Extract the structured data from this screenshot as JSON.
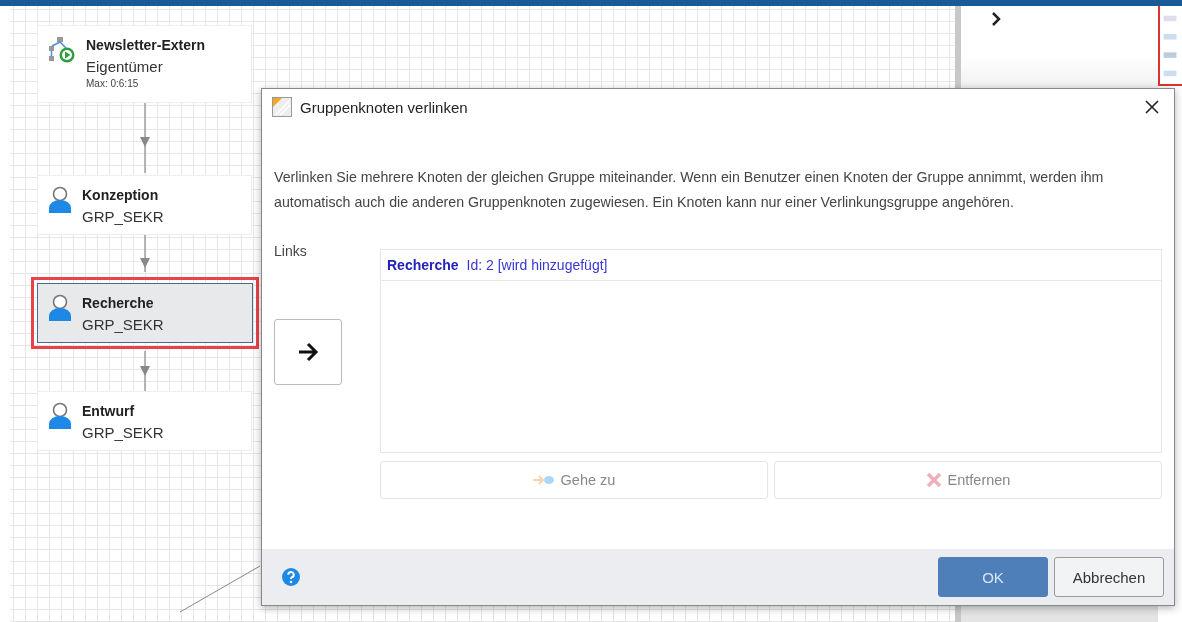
{
  "diagram": {
    "nodes": [
      {
        "kind": "process",
        "title": "Newsletter-Extern",
        "subtitle": "Eigentümer",
        "note": "Max: 0:6:15",
        "selected": false
      },
      {
        "kind": "user",
        "title": "Konzeption",
        "subtitle": "GRP_SEKR",
        "selected": false
      },
      {
        "kind": "user",
        "title": "Recherche",
        "subtitle": "GRP_SEKR",
        "selected": true
      },
      {
        "kind": "user",
        "title": "Entwurf",
        "subtitle": "GRP_SEKR",
        "selected": false
      }
    ]
  },
  "dialog": {
    "title": "Gruppenknoten verlinken",
    "description": "Verlinken Sie mehrere Knoten der gleichen Gruppe miteinander. Wenn ein Benutzer einen Knoten der Gruppe annimmt, werden ihm automatisch auch die anderen Gruppenknoten zugewiesen. Ein Knoten kann nur einer Verlinkungsgruppe angehören.",
    "links_label": "Links",
    "links": [
      {
        "name": "Recherche",
        "detail": "Id: 2 [wird hinzugefügt]"
      }
    ],
    "actions": [
      {
        "kind": "goto",
        "label": "Gehe zu",
        "disabled": true
      },
      {
        "kind": "remove",
        "label": "Entfernen",
        "disabled": true
      }
    ],
    "buttons": [
      {
        "label": "OK",
        "primary": true
      },
      {
        "label": "Abbrechen",
        "primary": false
      }
    ]
  }
}
